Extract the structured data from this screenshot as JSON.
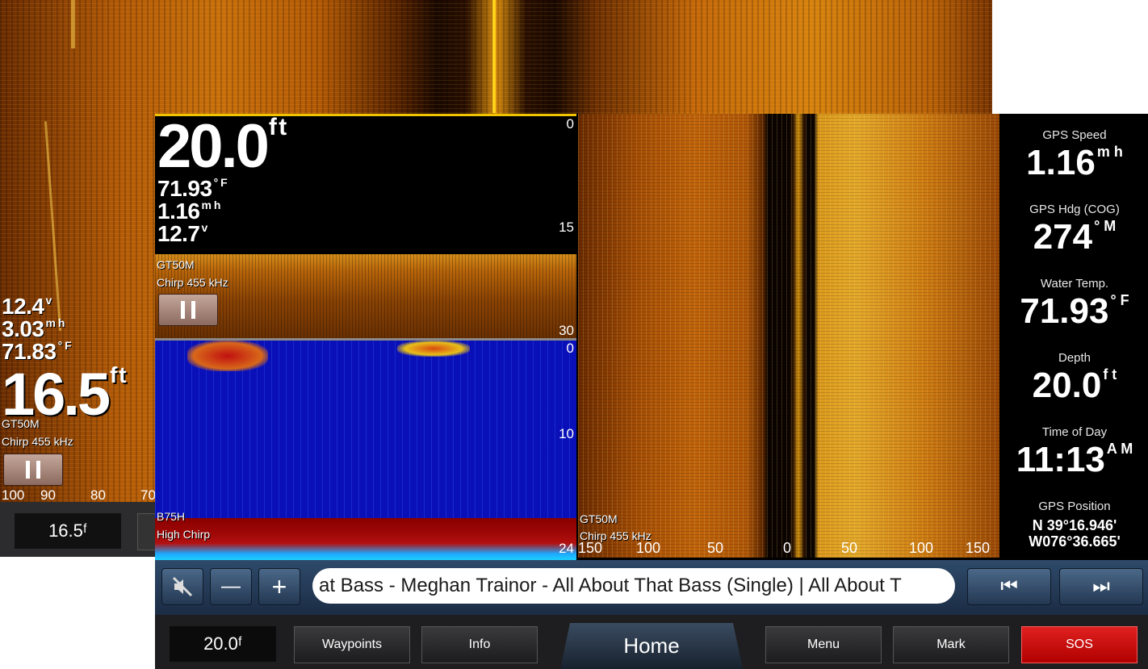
{
  "background_screen": {
    "readouts": {
      "voltage": "12.4",
      "voltage_unit": "v",
      "speed": "3.03",
      "speed_unit": "m h",
      "temperature": "71.83",
      "temperature_unit": "° F"
    },
    "depth": {
      "value": "16.5",
      "unit": "f t"
    },
    "transducer": "GT50M",
    "frequency": "Chirp 455 kHz",
    "scale": [
      "100",
      "90",
      "80",
      "70"
    ],
    "depth_box": "16.5ᶠ"
  },
  "top_pane": {
    "depth": {
      "value": "20.0",
      "unit": "f t"
    },
    "temperature": {
      "value": "71.93",
      "unit": "° F"
    },
    "speed": {
      "value": "1.16",
      "unit": "m h"
    },
    "voltage": {
      "value": "12.7",
      "unit": "v"
    },
    "transducer": "GT50M",
    "frequency": "Chirp 455 kHz",
    "scale": [
      "0",
      "15",
      "30"
    ]
  },
  "mid_pane": {
    "transducer": "B75H",
    "frequency": "High Chirp",
    "scale": [
      "0",
      "10",
      "24"
    ]
  },
  "right_pane": {
    "transducer": "GT50M",
    "frequency": "Chirp 455 kHz",
    "hscale": [
      "150",
      "100",
      "50",
      "0",
      "50",
      "100",
      "150"
    ]
  },
  "sidebar": {
    "gps_speed": {
      "title": "GPS Speed",
      "value": "1.16",
      "unit": "m h"
    },
    "gps_heading": {
      "title": "GPS Hdg (COG)",
      "value": "274",
      "unit": "° M"
    },
    "water_temp": {
      "title": "Water Temp.",
      "value": "71.93",
      "unit": "° F"
    },
    "depth": {
      "title": "Depth",
      "value": "20.0",
      "unit": "f t"
    },
    "time": {
      "title": "Time of Day",
      "value": "11:13",
      "unit": "A M"
    },
    "position": {
      "title": "GPS Position",
      "lat": "N  39°16.946'",
      "lon": "W076°36.665'"
    }
  },
  "media": {
    "mute": "mute-icon",
    "minus": "—",
    "plus": "+",
    "now_playing": "at Bass - Meghan Trainor - All About That Bass (Single)  |  All About T",
    "prev": "⏮",
    "next": "⏭"
  },
  "nav": {
    "depth_box": "20.0ᶠ",
    "waypoints": "Waypoints",
    "info": "Info",
    "home": "Home",
    "menu": "Menu",
    "mark": "Mark",
    "sos": "SOS"
  }
}
